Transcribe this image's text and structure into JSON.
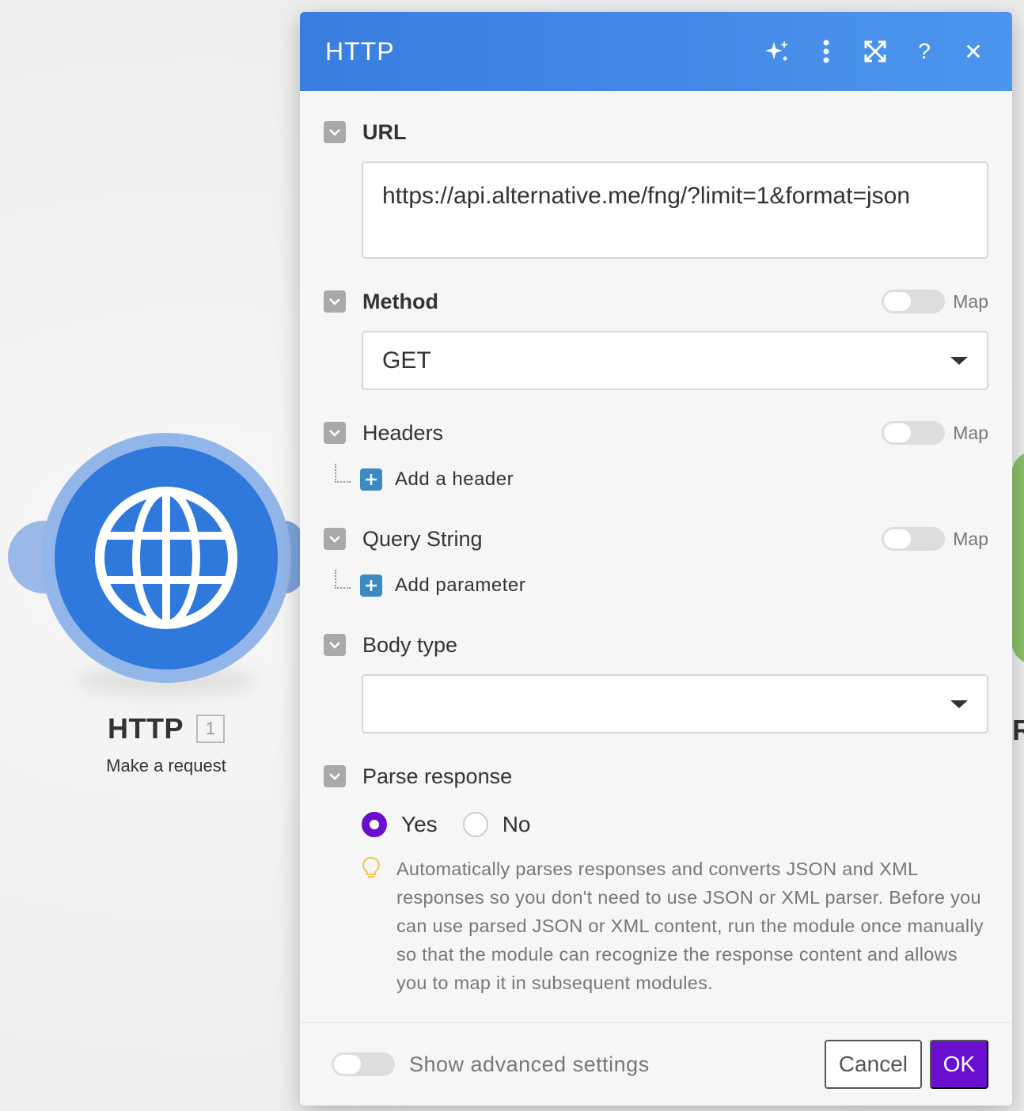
{
  "module": {
    "title": "HTTP",
    "badge": "1",
    "subtitle": "Make a request",
    "next_module_letter": "R"
  },
  "dialog": {
    "title": "HTTP",
    "header_icons": [
      "sparkle-icon",
      "more-vertical-icon",
      "expand-icon",
      "help-icon",
      "close-icon"
    ]
  },
  "fields": {
    "url": {
      "label": "URL",
      "value": "https://api.alternative.me/fng/?limit=1&format=json"
    },
    "method": {
      "label": "Method",
      "map_label": "Map",
      "value": "GET"
    },
    "headers": {
      "label": "Headers",
      "map_label": "Map",
      "add_label": "Add a header"
    },
    "query_string": {
      "label": "Query String",
      "map_label": "Map",
      "add_label": "Add parameter"
    },
    "body_type": {
      "label": "Body type",
      "value": ""
    },
    "parse_response": {
      "label": "Parse response",
      "options": [
        "Yes",
        "No"
      ],
      "selected": "Yes",
      "hint": "Automatically parses responses and converts JSON and XML responses so you don't need to use JSON or XML parser. Before you can use parsed JSON or XML content, run the module once manually so that the module can recognize the response content and allows you to map it in subsequent modules."
    }
  },
  "footer": {
    "advanced_label": "Show advanced settings",
    "cancel_label": "Cancel",
    "ok_label": "OK"
  },
  "colors": {
    "header_blue": "#3a7de0",
    "module_blue": "#2f78dc",
    "ok_purple": "#6a0fcf",
    "plus_blue": "#3b8bc2"
  }
}
